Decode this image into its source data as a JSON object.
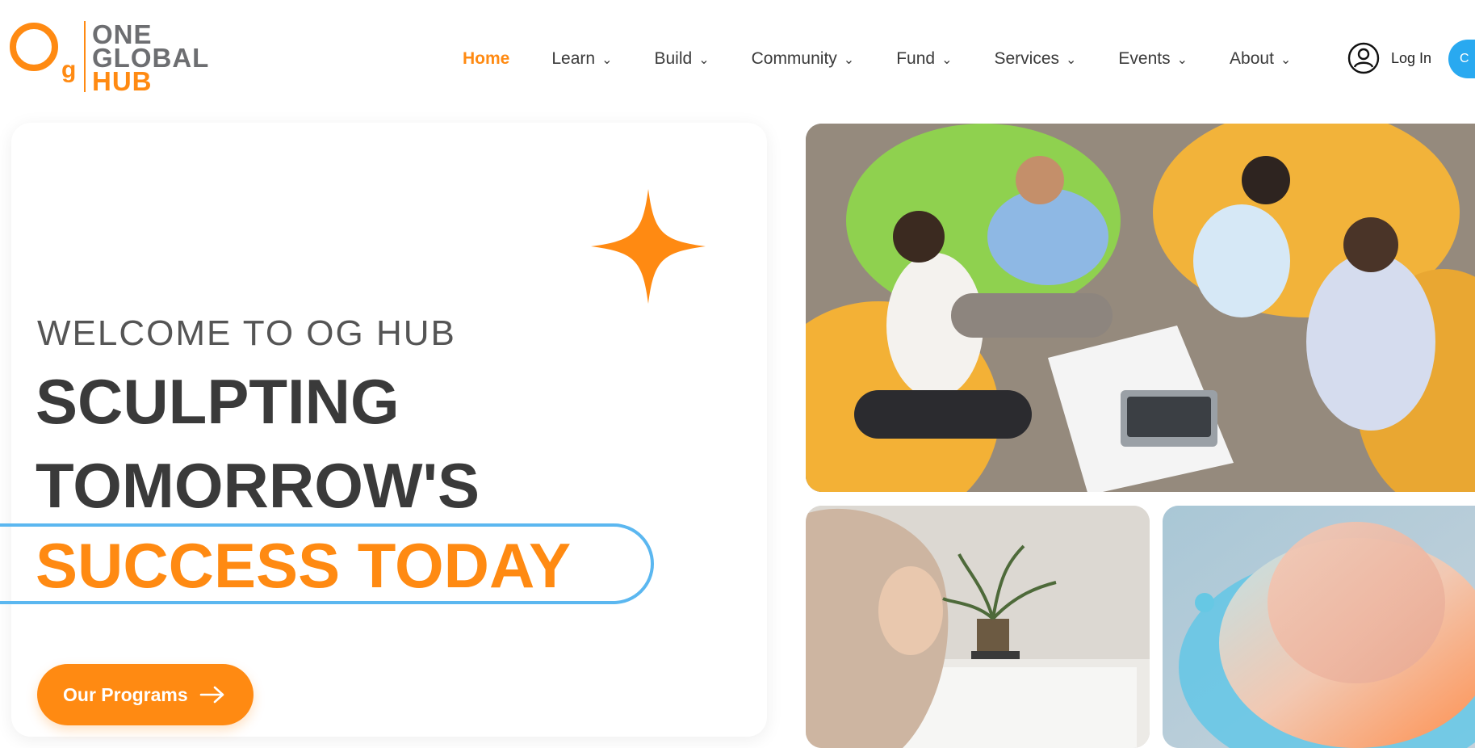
{
  "brand": {
    "logo_line1": "ONE",
    "logo_line2": "GLOBAL",
    "logo_line3": "HUB",
    "logo_mark_g": "g",
    "primary_color": "#ff8a12",
    "secondary_color": "#5bb7f0",
    "text_color": "#3a3a3a"
  },
  "nav": {
    "items": [
      {
        "label": "Home",
        "active": true,
        "has_dropdown": false
      },
      {
        "label": "Learn",
        "active": false,
        "has_dropdown": true
      },
      {
        "label": "Build",
        "active": false,
        "has_dropdown": true
      },
      {
        "label": "Community",
        "active": false,
        "has_dropdown": true
      },
      {
        "label": "Fund",
        "active": false,
        "has_dropdown": true
      },
      {
        "label": "Services",
        "active": false,
        "has_dropdown": true
      },
      {
        "label": "Events",
        "active": false,
        "has_dropdown": true
      },
      {
        "label": "About",
        "active": false,
        "has_dropdown": true
      }
    ],
    "dropdown_icon": "chevron-down-icon"
  },
  "account": {
    "login_label": "Log In",
    "login_icon": "user-circle-icon",
    "cta_partial_label": "C"
  },
  "hero": {
    "welcome": "WELCOME TO OG HUB",
    "headline_line1": "SCULPTING",
    "headline_line2": "TOMORROW'S",
    "headline_line3": "SUCCESS TODAY",
    "button_label": "Our Programs",
    "button_icon": "arrow-right-icon",
    "decor_icon": "sparkle-icon"
  },
  "images": {
    "meeting": "team-meeting-photo",
    "woman": "woman-working-photo",
    "abstract": "abstract-3d-render"
  }
}
